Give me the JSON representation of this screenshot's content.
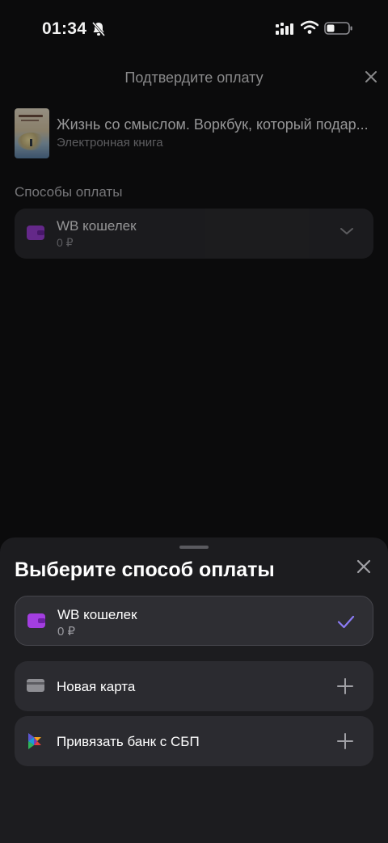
{
  "status": {
    "time": "01:34"
  },
  "background": {
    "title": "Подтвердите оплату",
    "book": {
      "title": "Жизнь со смыслом. Воркбук, который подар...",
      "type": "Электронная книга"
    },
    "section_title": "Способы оплаты",
    "selected_method": {
      "name": "WB кошелек",
      "balance": "0 ₽"
    }
  },
  "sheet": {
    "title": "Выберите способ оплаты",
    "options": [
      {
        "name": "WB кошелек",
        "sub": "0 ₽",
        "icon": "wallet-icon",
        "action": "checkmark-icon",
        "selected": true
      },
      {
        "name": "Новая карта",
        "icon": "card-icon",
        "action": "plus-icon",
        "selected": false
      },
      {
        "name": "Привязать банк с СБП",
        "icon": "sbp-logo-icon",
        "action": "plus-icon",
        "selected": false
      }
    ]
  },
  "colors": {
    "accent": "#8b5cf6",
    "wallet": "#9b3bd6",
    "sheet_bg": "#1c1c1f",
    "option_bg": "#2b2b30"
  }
}
